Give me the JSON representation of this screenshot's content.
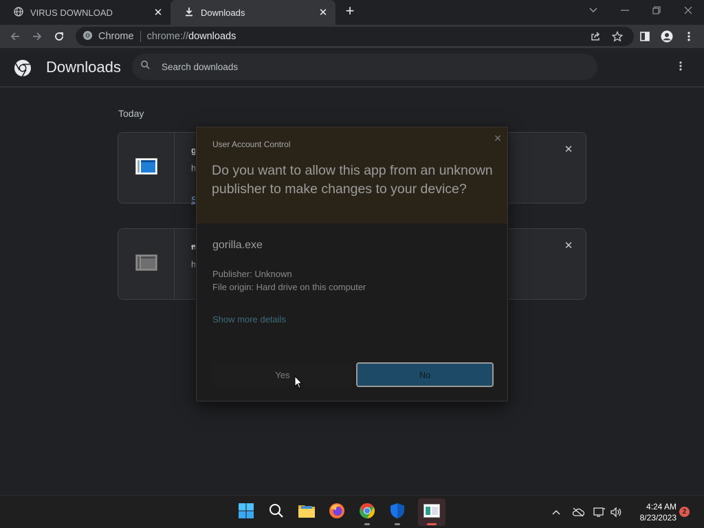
{
  "tabs": [
    {
      "title": "VIRUS DOWNLOAD",
      "active": false,
      "icon": "globe-icon"
    },
    {
      "title": "Downloads",
      "active": true,
      "icon": "download-icon"
    }
  ],
  "toolbar": {
    "omnibox_site": "Chrome",
    "url_scheme": "chrome://",
    "url_host": "downloads"
  },
  "downloads_page": {
    "title": "Downloads",
    "search_placeholder": "Search downloads",
    "section_label": "Today",
    "items": [
      {
        "name_visible": "g",
        "url_visible": "h",
        "link_visible": "S"
      },
      {
        "name_visible": "n",
        "url_visible": "h",
        "link_visible": ""
      }
    ]
  },
  "uac": {
    "caption": "User Account Control",
    "question": "Do you want to allow this app from an unknown publisher to make changes to your device?",
    "app_name": "gorilla.exe",
    "publisher": "Publisher: Unknown",
    "file_origin": "File origin: Hard drive on this computer",
    "more_details": "Show more details",
    "yes_label": "Yes",
    "no_label": "No"
  },
  "taskbar": {
    "time": "4:24 AM",
    "date": "8/23/2023",
    "notification_count": "2"
  },
  "colors": {
    "accent_blue": "#8ab4f8",
    "uac_no_button": "#1d4a66",
    "notification_badge": "#e05a4f"
  }
}
